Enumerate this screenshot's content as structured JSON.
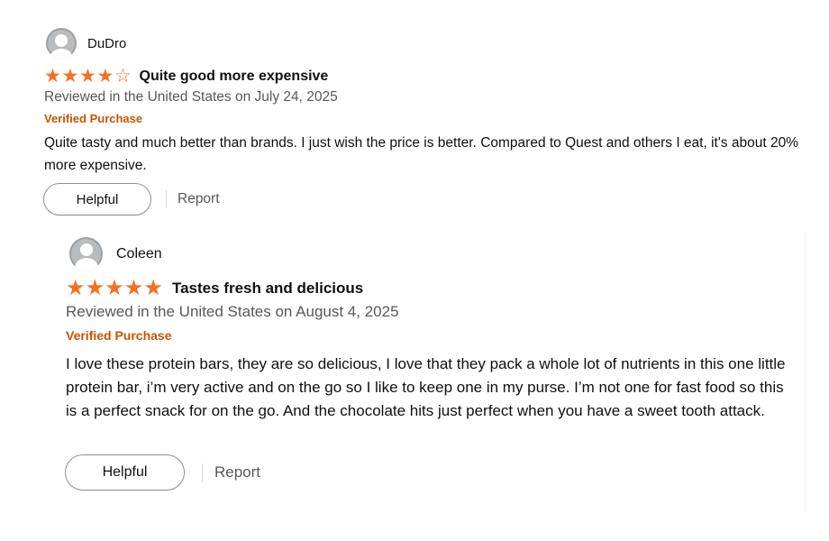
{
  "reviews": [
    {
      "reviewer": "DuDro",
      "rating": 4,
      "rating_max": 5,
      "title": "Quite good more expensive",
      "date_line": "Reviewed in the United States on July 24, 2025",
      "verified_label": "Verified Purchase",
      "body": "Quite tasty and much better than brands. I just wish the price is better. Compared to Quest and others I eat, it's about 20% more expensive.",
      "helpful_label": "Helpful",
      "report_label": "Report"
    },
    {
      "reviewer": "Coleen",
      "rating": 5,
      "rating_max": 5,
      "title": "Tastes fresh and delicious",
      "date_line": "Reviewed in the United States on August 4, 2025",
      "verified_label": "Verified Purchase",
      "body": "I love these protein bars, they are so delicious, I love that they pack a whole lot of nutrients in this one little protein bar, i’m very active and on the go so I like to keep one in my purse. I’m not one for fast food so this is a perfect snack for on the go. And the chocolate hits just perfect when you have a sweet tooth attack.",
      "helpful_label": "Helpful",
      "report_label": "Report"
    }
  ],
  "icons": {
    "avatar": "default-user-avatar-icon",
    "star_filled": "star-filled-icon",
    "star_empty": "star-empty-icon"
  },
  "colors": {
    "star": "#f37021",
    "verified": "#c45500",
    "muted_text": "#565959",
    "text": "#0f1111"
  }
}
